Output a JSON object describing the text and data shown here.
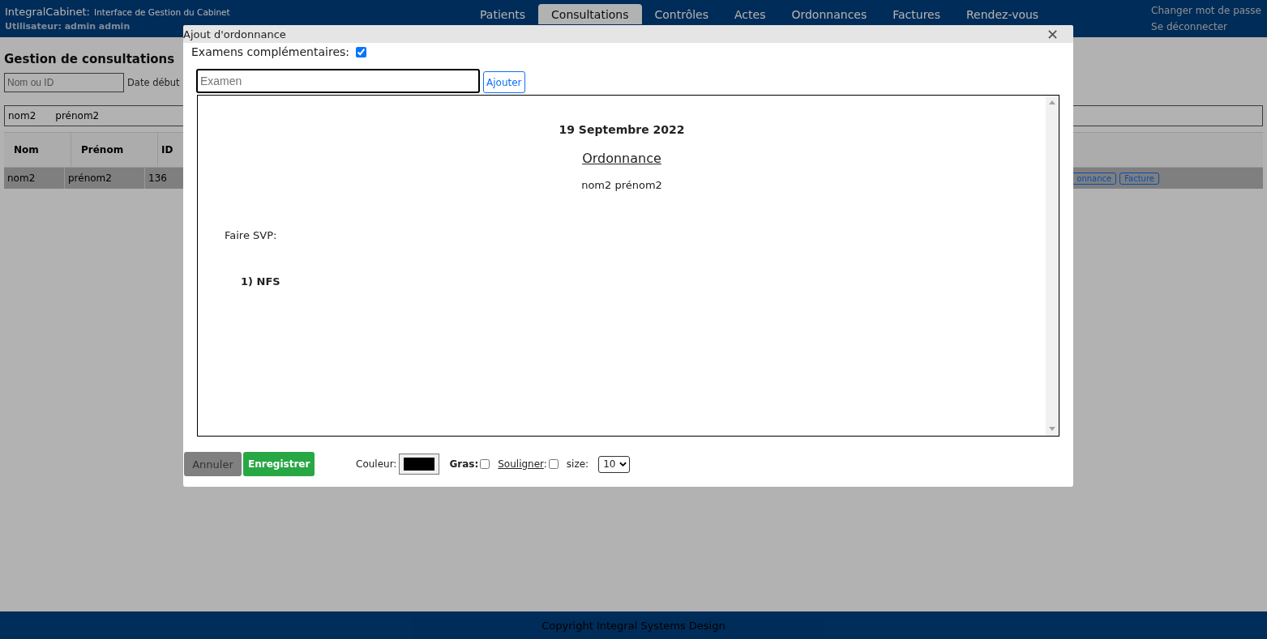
{
  "header": {
    "brand": "IntegralCabinet:",
    "subtitle": "Interface de Gestion du Cabinet",
    "user": "Utilisateur: admin admin",
    "tabs": [
      {
        "label": "Patients",
        "selected": false
      },
      {
        "label": "Consultations",
        "selected": true
      },
      {
        "label": "Contrôles",
        "selected": false
      },
      {
        "label": "Actes",
        "selected": false
      },
      {
        "label": "Ordonnances",
        "selected": false
      },
      {
        "label": "Factures",
        "selected": false
      },
      {
        "label": "Rendez-vous",
        "selected": false
      }
    ],
    "links": [
      "Changer mot de passe",
      "Se déconnecter"
    ]
  },
  "page": {
    "title": "Gestion de consultations",
    "search_placeholder": "Nom ou ID",
    "date_label": "Date début",
    "patient_select": [
      "nom2",
      "prénom2"
    ],
    "columns": [
      "Nom",
      "Prénom",
      "ID"
    ],
    "rows": [
      {
        "cells": [
          "nom2",
          "prénom2",
          "136"
        ],
        "selected": true,
        "actions": [
          "onnance",
          "Facture"
        ]
      }
    ]
  },
  "dialog": {
    "title": "Ajout d'ordonnance",
    "exams_label": "Examens complémentaires:",
    "exams_checked": true,
    "exam_placeholder": "Examen",
    "add_button": "Ajouter",
    "document": {
      "date": "19 Septembre 2022",
      "heading": "Ordonnance",
      "patient": "nom2 prénom2",
      "intro": "Faire SVP:",
      "items": [
        "1) NFS"
      ]
    },
    "cancel": "Annuler",
    "save": "Enregistrer",
    "color_label": "Couleur:",
    "color": "#000000",
    "bold_label": "Gras:",
    "bold_checked": false,
    "underline_label": "Souligner",
    "underline_suffix": ":",
    "underline_checked": false,
    "size_label": "size:",
    "size": "10"
  },
  "footer": {
    "copyright": "Copyright Integral Systems Design"
  }
}
